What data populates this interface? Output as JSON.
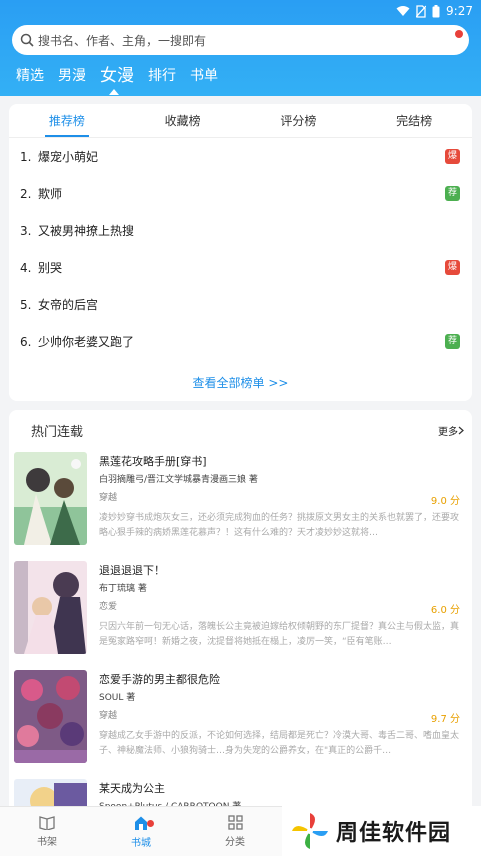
{
  "status_bar": {
    "time": "9:27"
  },
  "search": {
    "placeholder": "搜书名、作者、主角，一搜即有"
  },
  "nav_tabs": [
    "精选",
    "男漫",
    "女漫",
    "排行",
    "书单"
  ],
  "rank": {
    "tabs": [
      "推荐榜",
      "收藏榜",
      "评分榜",
      "完结榜"
    ],
    "items": [
      {
        "num": "1.",
        "title": "爆宠小萌妃",
        "badge": "爆",
        "badge_color": "#e64a3b"
      },
      {
        "num": "2.",
        "title": "欺师",
        "badge": "荐",
        "badge_color": "#4caf50"
      },
      {
        "num": "3.",
        "title": "又被男神撩上热搜",
        "badge": "",
        "badge_color": ""
      },
      {
        "num": "4.",
        "title": "别哭",
        "badge": "爆",
        "badge_color": "#e64a3b"
      },
      {
        "num": "5.",
        "title": "女帝的后宫",
        "badge": "",
        "badge_color": ""
      },
      {
        "num": "6.",
        "title": "少帅你老婆又跑了",
        "badge": "荐",
        "badge_color": "#4caf50"
      }
    ],
    "view_all": "查看全部榜单 >>"
  },
  "hot": {
    "title": "热门连载",
    "more": "更多",
    "books": [
      {
        "title": "黑莲花攻略手册[穿书]",
        "author": "白羽摘雕弓/晋江文学城暴青漫画三娘 著",
        "genre": "穿越",
        "score": "9.0 分",
        "desc": "凌妙妙穿书成炮灰女三，还必须完成狗血的任务？挑拨原文男女主的关系也就罢了，还要攻略心狠手辣的病娇黑莲花慕声？！这有什么难的？天才凌妙妙这就将…"
      },
      {
        "title": "退退退退下！",
        "author": "布丁琉璃 著",
        "genre": "恋爱",
        "score": "6.0 分",
        "desc": "只因六年前一句无心话，落魄长公主竟被迫嫁给权倾朝野的东厂提督？真公主与假太监，真是冤家路窄呵！新婚之夜，沈提督将她抵在榻上，凌厉一笑，“臣有笔账…"
      },
      {
        "title": "恋爱手游的男主都很危险",
        "author": "SOUL 著",
        "genre": "穿越",
        "score": "9.7 分",
        "desc": "穿越成乙女手游中的反派，不论如何选择，结局都是死亡？冷漠大哥、毒舌二哥、嗜血皇太子、神秘魔法师、小狼狗骑士…身为失宠的公爵养女，在\"真正的公爵千…"
      },
      {
        "title": "某天成为公主",
        "author": "Spoon+Plutus / CARROTOON 著",
        "genre": "",
        "score": "",
        "desc": ""
      }
    ]
  },
  "bottom_tabs": [
    "书架",
    "书城",
    "分类"
  ],
  "watermark": {
    "text": "周佳软件园"
  },
  "colors": {
    "accent": "#1e8fe8",
    "header": "#2a9ef3",
    "score": "#e8a000"
  }
}
